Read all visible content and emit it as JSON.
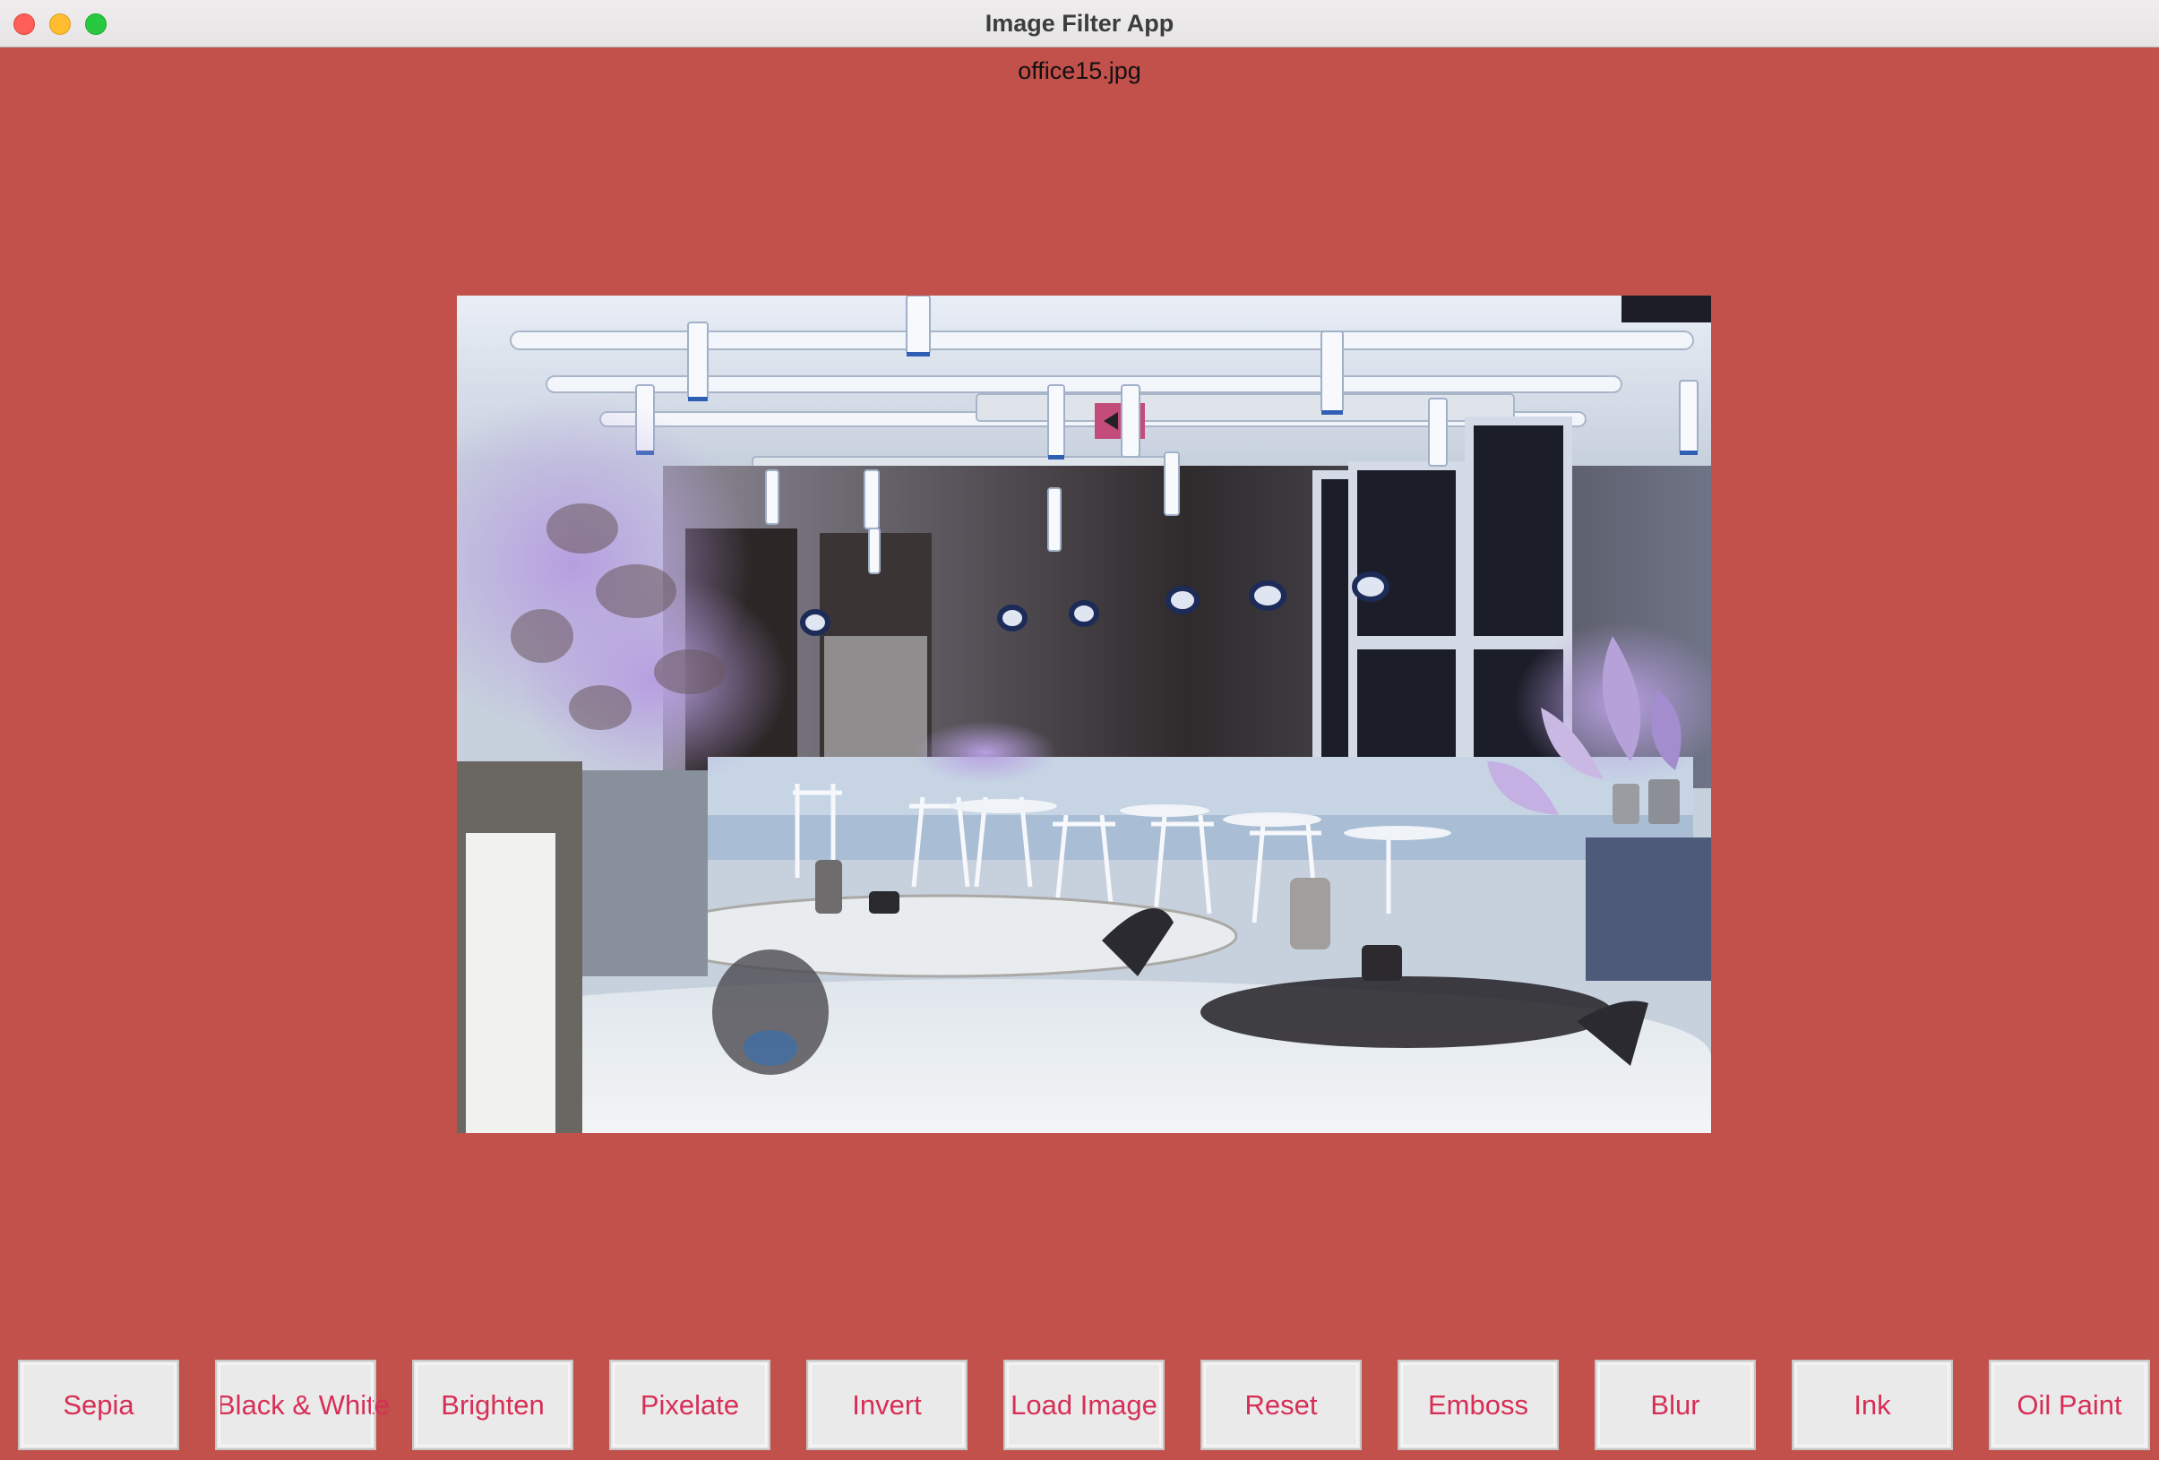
{
  "window": {
    "title": "Image Filter App"
  },
  "image": {
    "filename": "office15.jpg"
  },
  "toolbar": {
    "buttons": [
      {
        "label": "Sepia"
      },
      {
        "label": "Black & White"
      },
      {
        "label": "Brighten"
      },
      {
        "label": "Pixelate"
      },
      {
        "label": "Invert"
      },
      {
        "label": "Load Image"
      },
      {
        "label": "Reset"
      },
      {
        "label": "Emboss"
      },
      {
        "label": "Blur"
      },
      {
        "label": "Ink"
      },
      {
        "label": "Oil Paint"
      }
    ]
  },
  "colors": {
    "background": "#c2504b",
    "button_text": "#d72e55"
  }
}
